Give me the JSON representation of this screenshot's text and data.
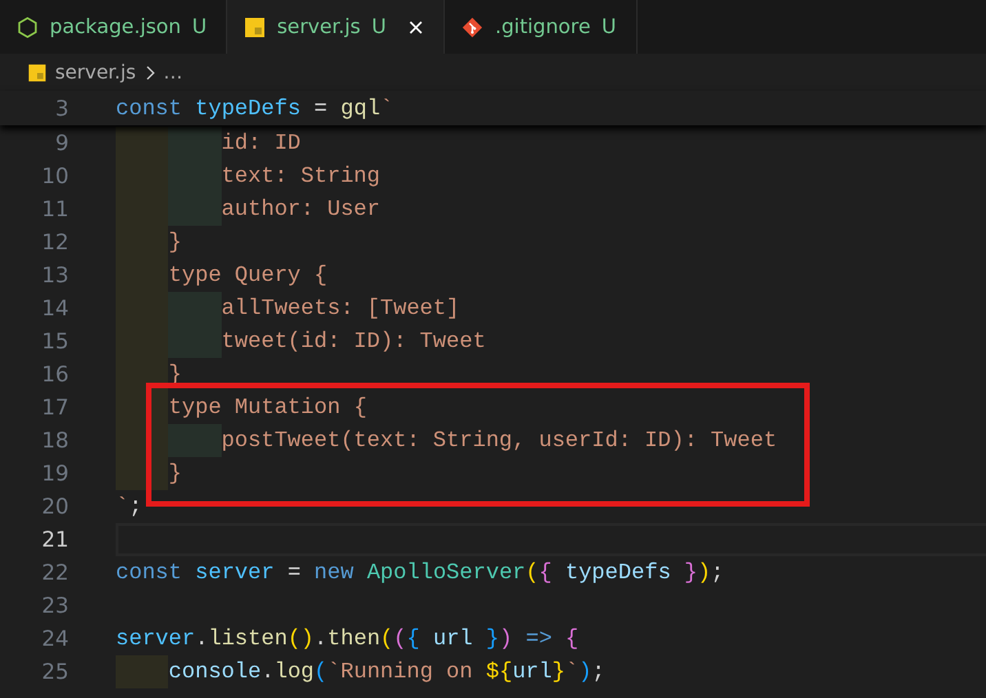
{
  "tabs": [
    {
      "label": "package.json",
      "status": "U",
      "selected": false
    },
    {
      "label": "server.js",
      "status": "U",
      "selected": true
    },
    {
      "label": ".gitignore",
      "status": "U",
      "selected": false
    }
  ],
  "breadcrumb": {
    "file": "server.js",
    "more": "…"
  },
  "sticky_line": {
    "number": "3",
    "tokens": [
      {
        "text": "const ",
        "kind": "keyword"
      },
      {
        "text": "typeDefs",
        "kind": "const"
      },
      {
        "text": " = ",
        "kind": "punct"
      },
      {
        "text": "gql",
        "kind": "function"
      },
      {
        "text": "`",
        "kind": "string"
      }
    ]
  },
  "lines": [
    {
      "number": "9",
      "current": false,
      "highlighted": false,
      "tokens": [
        {
          "text": "        id: ID",
          "kind": "string"
        }
      ]
    },
    {
      "number": "10",
      "current": false,
      "highlighted": false,
      "tokens": [
        {
          "text": "        text: String",
          "kind": "string"
        }
      ]
    },
    {
      "number": "11",
      "current": false,
      "highlighted": false,
      "tokens": [
        {
          "text": "        author: User",
          "kind": "string"
        }
      ]
    },
    {
      "number": "12",
      "current": false,
      "highlighted": false,
      "tokens": [
        {
          "text": "    }",
          "kind": "string"
        }
      ]
    },
    {
      "number": "13",
      "current": false,
      "highlighted": false,
      "tokens": [
        {
          "text": "    type Query {",
          "kind": "string"
        }
      ]
    },
    {
      "number": "14",
      "current": false,
      "highlighted": false,
      "tokens": [
        {
          "text": "        allTweets: [Tweet]",
          "kind": "string"
        }
      ]
    },
    {
      "number": "15",
      "current": false,
      "highlighted": false,
      "tokens": [
        {
          "text": "        tweet(id: ID): Tweet",
          "kind": "string"
        }
      ]
    },
    {
      "number": "16",
      "current": false,
      "highlighted": false,
      "tokens": [
        {
          "text": "    }",
          "kind": "string"
        }
      ]
    },
    {
      "number": "17",
      "current": false,
      "highlighted": true,
      "tokens": [
        {
          "text": "    type Mutation {",
          "kind": "string"
        }
      ]
    },
    {
      "number": "18",
      "current": false,
      "highlighted": true,
      "tokens": [
        {
          "text": "        postTweet(text: String, userId: ID): Tweet",
          "kind": "string"
        }
      ]
    },
    {
      "number": "19",
      "current": false,
      "highlighted": true,
      "tokens": [
        {
          "text": "    }",
          "kind": "string"
        }
      ]
    },
    {
      "number": "20",
      "current": false,
      "highlighted": false,
      "tokens": [
        {
          "text": "`",
          "kind": "string"
        },
        {
          "text": ";",
          "kind": "punct"
        }
      ]
    },
    {
      "number": "21",
      "current": true,
      "highlighted": false
    },
    {
      "number": "22",
      "current": false,
      "highlighted": false,
      "tokens": [
        {
          "text": "const ",
          "kind": "keyword"
        },
        {
          "text": "server",
          "kind": "const"
        },
        {
          "text": " = ",
          "kind": "punct"
        },
        {
          "text": "new ",
          "kind": "keyword"
        },
        {
          "text": "ApolloServer",
          "kind": "class"
        },
        {
          "text": "(",
          "kind": "bracket1"
        },
        {
          "text": "{",
          "kind": "bracket2"
        },
        {
          "text": " typeDefs ",
          "kind": "variable"
        },
        {
          "text": "}",
          "kind": "bracket2"
        },
        {
          "text": ")",
          "kind": "bracket1"
        },
        {
          "text": ";",
          "kind": "punct"
        }
      ]
    },
    {
      "number": "23",
      "current": false,
      "highlighted": false
    },
    {
      "number": "24",
      "current": false,
      "highlighted": false,
      "tokens": [
        {
          "text": "server",
          "kind": "const"
        },
        {
          "text": ".",
          "kind": "punct"
        },
        {
          "text": "listen",
          "kind": "function"
        },
        {
          "text": "()",
          "kind": "bracket1"
        },
        {
          "text": ".",
          "kind": "punct"
        },
        {
          "text": "then",
          "kind": "function"
        },
        {
          "text": "(",
          "kind": "bracket1"
        },
        {
          "text": "(",
          "kind": "bracket2"
        },
        {
          "text": "{",
          "kind": "bracket3"
        },
        {
          "text": " url ",
          "kind": "variable"
        },
        {
          "text": "}",
          "kind": "bracket3"
        },
        {
          "text": ")",
          "kind": "bracket2"
        },
        {
          "text": " => ",
          "kind": "keyword"
        },
        {
          "text": "{",
          "kind": "bracket2"
        }
      ]
    },
    {
      "number": "25",
      "current": false,
      "highlighted": false,
      "tokens": [
        {
          "text": "    console",
          "kind": "variable"
        },
        {
          "text": ".",
          "kind": "punct"
        },
        {
          "text": "log",
          "kind": "function"
        },
        {
          "text": "(",
          "kind": "bracket3"
        },
        {
          "text": "`Running on ",
          "kind": "string"
        },
        {
          "text": "${",
          "kind": "bracket1"
        },
        {
          "text": "url",
          "kind": "variable"
        },
        {
          "text": "}",
          "kind": "bracket1"
        },
        {
          "text": "`",
          "kind": "string"
        },
        {
          "text": ")",
          "kind": "bracket3"
        },
        {
          "text": ";",
          "kind": "punct"
        }
      ]
    }
  ]
}
